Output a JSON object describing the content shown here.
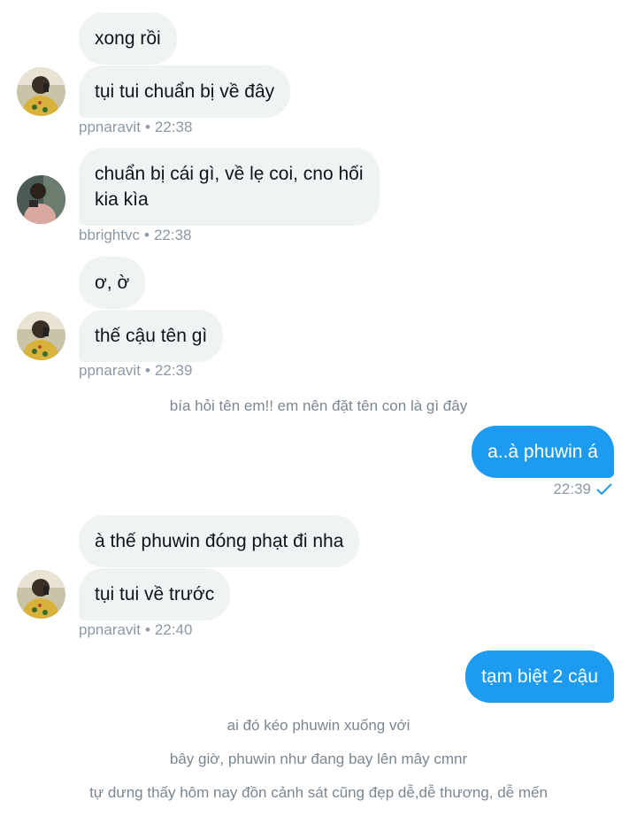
{
  "conversation": {
    "group1": {
      "messages": [
        "xong rồi",
        "tụi tui chuẩn bị về đây"
      ],
      "username": "ppnaravit",
      "time": "22:38",
      "avatar_icon": "user-avatar"
    },
    "group2": {
      "messages": [
        "chuẩn bị cái gì, về lẹ coi, cno hối\nkia kìa"
      ],
      "username": "bbrightvc",
      "time": "22:38",
      "avatar_icon": "user-avatar"
    },
    "group3": {
      "messages": [
        "ơ, ờ",
        "thế cậu tên gì"
      ],
      "username": "ppnaravit",
      "time": "22:39"
    },
    "caption1": "bía hỏi tên em!! em nên đặt tên con là gì đây",
    "outgoing1": {
      "text": "a..à phuwin á",
      "time": "22:39",
      "status_icon": "check-icon"
    },
    "group4": {
      "messages": [
        "à thế phuwin đóng phạt đi nha",
        "tụi tui về trước"
      ],
      "username": "ppnaravit",
      "time": "22:40"
    },
    "outgoing2": {
      "text": "tạm biệt 2 cậu"
    },
    "captions": [
      "ai đó kéo phuwin xuống với",
      "bây giờ, phuwin như đang bay lên mây cmnr",
      "tự dưng thấy hôm nay đồn cảnh sát cũng đẹp dễ,dễ thương, dễ mến"
    ],
    "colors": {
      "outgoing": "#1d9bf0",
      "incoming": "#eff3f4",
      "meta": "#8b98a5"
    }
  }
}
